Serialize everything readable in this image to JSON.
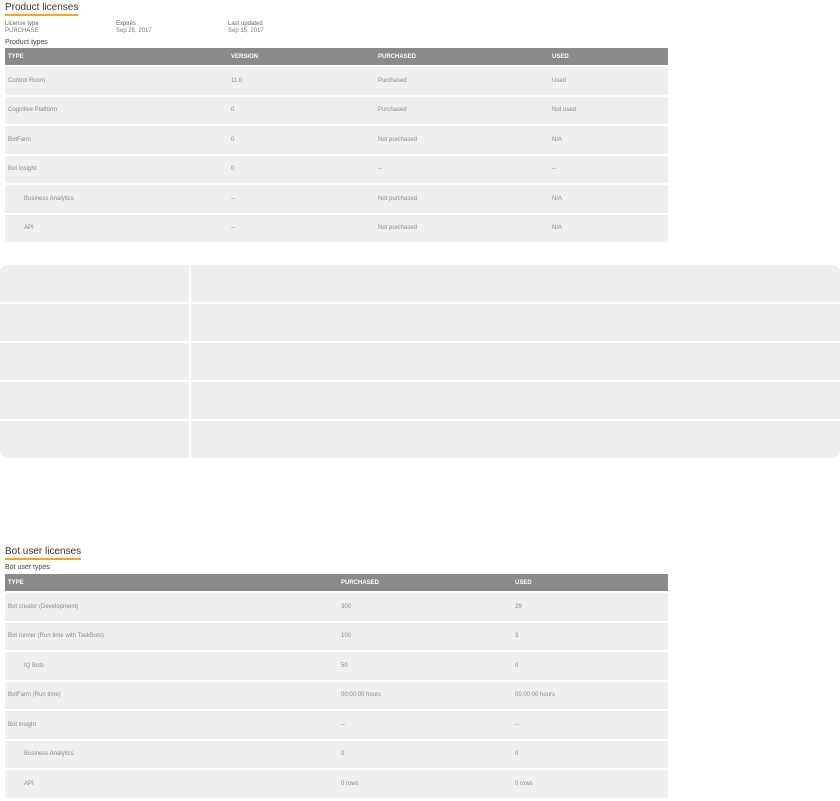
{
  "product_licenses": {
    "title": "Product licenses",
    "meta": [
      {
        "label": "License type",
        "value": "PURCHASE"
      },
      {
        "label": "Expires",
        "value": "Sep 25, 2017"
      },
      {
        "label": "Last updated",
        "value": "Sep 15, 2017"
      }
    ],
    "subtitle": "Product types",
    "headers": [
      "TYPE",
      "VERSION",
      "PURCHASED",
      "USED"
    ],
    "rows": [
      {
        "type": "Control Room",
        "version": "11.0",
        "purchased": "Purchased",
        "used": "Used",
        "indent": false
      },
      {
        "type": "Cognitive Platform",
        "version": "0",
        "purchased": "Purchased",
        "used": "Not used",
        "indent": false
      },
      {
        "type": "BotFarm",
        "version": "0",
        "purchased": "Not purchased",
        "used": "N/A",
        "indent": false
      },
      {
        "type": "Bot Insight",
        "version": "0",
        "purchased": "--",
        "used": "--",
        "indent": false
      },
      {
        "type": "Business Analytics",
        "version": "--",
        "purchased": "Not purchased",
        "used": "N/A",
        "indent": true
      },
      {
        "type": "API",
        "version": "--",
        "purchased": "Not purchased",
        "used": "N/A",
        "indent": true
      }
    ]
  },
  "bot_user_licenses": {
    "title": "Bot user licenses",
    "subtitle": "Bot user types",
    "headers": [
      "TYPE",
      "PURCHASED",
      "USED"
    ],
    "rows": [
      {
        "type": "Bot creator (Development)",
        "purchased": "300",
        "used": "29",
        "indent": false
      },
      {
        "type": "Bot runner (Run time with TaskBots)",
        "purchased": "100",
        "used": "3",
        "indent": false
      },
      {
        "type": "IQ Bots",
        "purchased": "50",
        "used": "0",
        "indent": true
      },
      {
        "type": "BotFarm (Run time)",
        "purchased": "00:00:00 hours",
        "used": "00:00:00 hours",
        "indent": false
      },
      {
        "type": "Bot insight",
        "purchased": "--",
        "used": "--",
        "indent": false
      },
      {
        "type": "Business Analytics",
        "purchased": "0",
        "used": "0",
        "indent": true
      },
      {
        "type": "API",
        "purchased": "0 rows",
        "used": "0 rows",
        "indent": true
      }
    ]
  }
}
